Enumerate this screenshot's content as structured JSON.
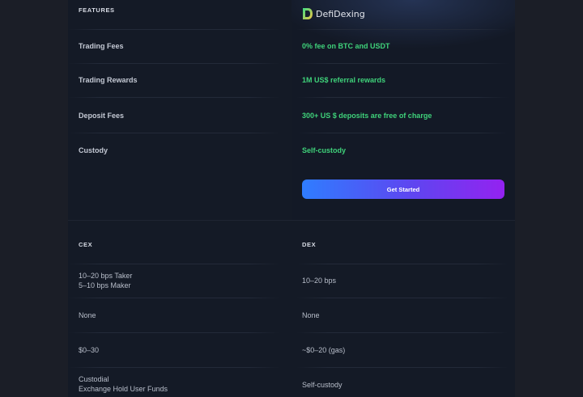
{
  "compare": {
    "features_header": "FEATURES",
    "brand_name": "DefiDexing",
    "rows": [
      {
        "label": "Trading Fees",
        "value": "0% fee on BTC and USDT"
      },
      {
        "label": "Trading Rewards",
        "value": "1M US$ referral rewards"
      },
      {
        "label": "Deposit Fees",
        "value": "300+ US $ deposits are free of charge"
      },
      {
        "label": "Custody",
        "value": "Self-custody"
      }
    ],
    "cta_label": "Get Started"
  },
  "table": {
    "cex_header": "CEX",
    "dex_header": "DEX",
    "rows": [
      {
        "cex_line1": "10–20 bps Taker",
        "cex_line2": "5–10 bps Maker",
        "dex": "10–20 bps"
      },
      {
        "cex_line1": "None",
        "cex_line2": "",
        "dex": "None"
      },
      {
        "cex_line1": "$0–30",
        "cex_line2": "",
        "dex": "~$0–20 (gas)"
      },
      {
        "cex_line1": "Custodial",
        "cex_line2": "Exchange Hold User Funds",
        "dex": "Self-custody"
      }
    ]
  },
  "colors": {
    "accent_green": "#3fd27a",
    "cta_gradient_start": "#2f7dff",
    "cta_gradient_end": "#9422f0"
  },
  "icons": [
    "defidexing-logo-icon"
  ]
}
